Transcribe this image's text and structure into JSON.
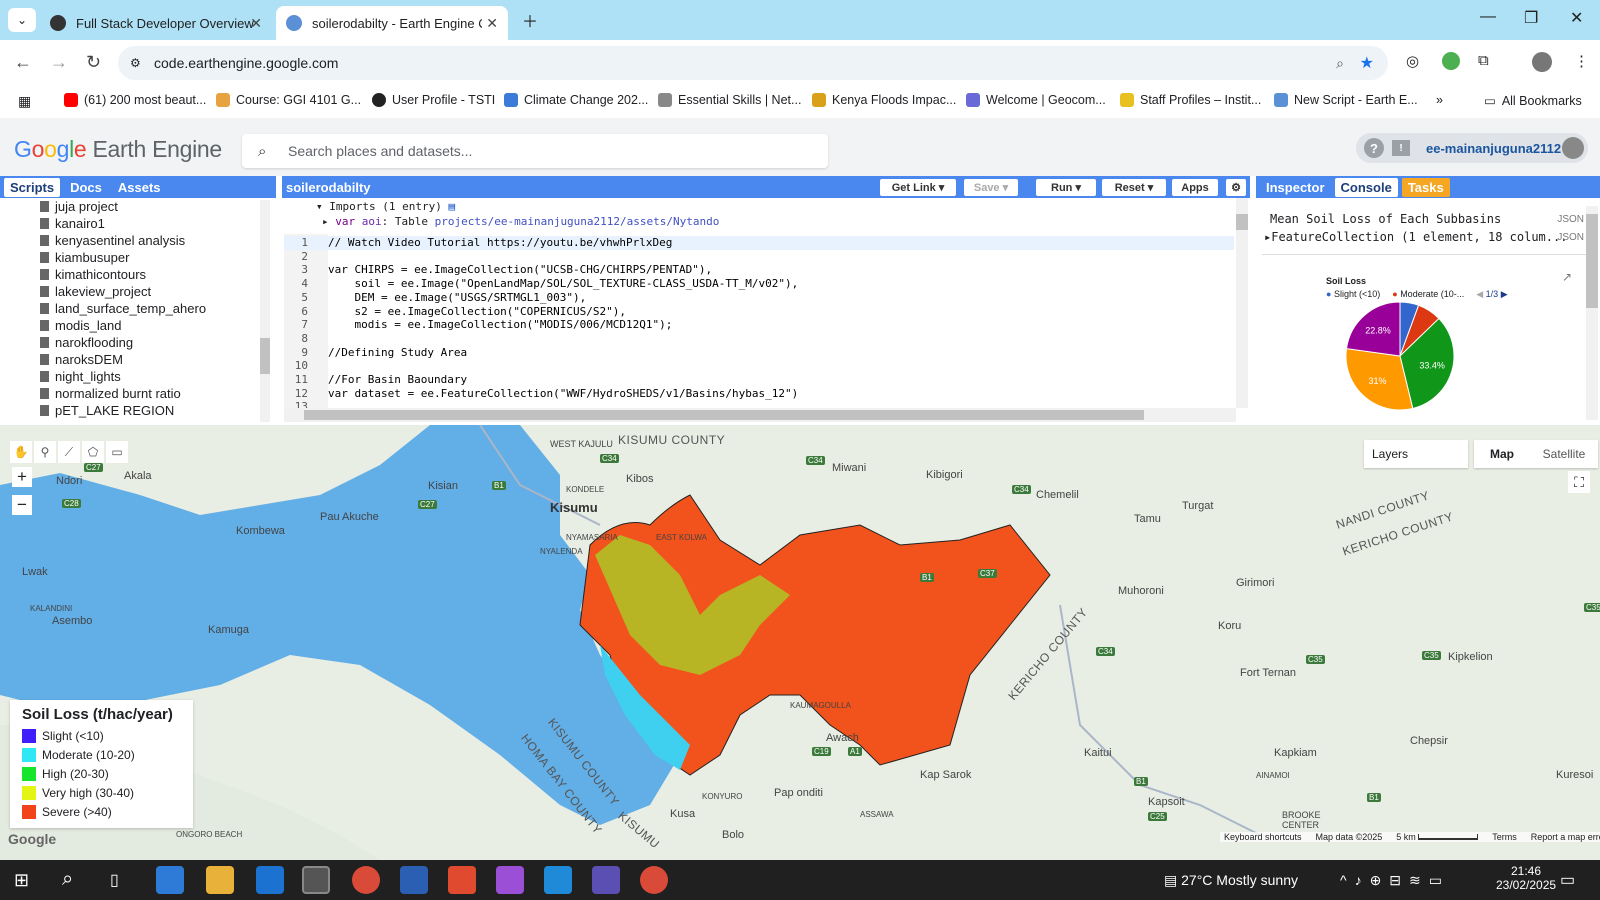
{
  "browser": {
    "tabs": [
      {
        "title": "Full Stack Developer Overview"
      },
      {
        "title": "soilerodabilty - Earth Engine Co"
      }
    ],
    "url": "code.earthengine.google.com",
    "bookmarks": [
      "(61) 200 most beaut...",
      "Course: GGI 4101 G...",
      "User Profile - TSTI",
      "Climate Change 202...",
      "Essential Skills | Net...",
      "Kenya Floods Impac...",
      "Welcome | Geocom...",
      "Staff Profiles – Instit...",
      "New Script - Earth E..."
    ],
    "all_bookmarks": "All Bookmarks"
  },
  "gee": {
    "logo": {
      "google": "Google",
      "product": "Earth Engine"
    },
    "search_placeholder": "Search places and datasets...",
    "user": "ee-mainanjuguna2112",
    "left_tabs": [
      "Scripts",
      "Docs",
      "Assets"
    ],
    "script_items": [
      "juja project",
      "kanairo1",
      "kenyasentinel analysis",
      "kiambusuper",
      "kimathicontours",
      "lakeview_project",
      "land_surface_temp_ahero",
      "modis_land",
      "narokflooding",
      "naroksDEM",
      "night_lights",
      "normalized burnt ratio",
      "pET_LAKE REGION"
    ],
    "script_name": "soilerodabilty",
    "editor_buttons": {
      "get_link": "Get Link",
      "save": "Save",
      "run": "Run",
      "reset": "Reset",
      "apps": "Apps"
    },
    "imports_header": "Imports (1 entry)",
    "import_line": {
      "prefix": "var ",
      "name": "aoi",
      "type": ": Table ",
      "path": "projects/ee-mainanjuguna2112/assets/Nytando"
    },
    "code_lines": [
      {
        "n": "1",
        "cls": "cmt",
        "text": "// Watch Video Tutorial https://youtu.be/vhwhPrlxDeg"
      },
      {
        "n": "2",
        "cls": "",
        "text": ""
      },
      {
        "n": "3",
        "cls": "",
        "text": "var CHIRPS = ee.ImageCollection(\"UCSB-CHG/CHIRPS/PENTAD\"),"
      },
      {
        "n": "4",
        "cls": "",
        "text": "    soil = ee.Image(\"OpenLandMap/SOL/SOL_TEXTURE-CLASS_USDA-TT_M/v02\"),"
      },
      {
        "n": "5",
        "cls": "",
        "text": "    DEM = ee.Image(\"USGS/SRTMGL1_003\"),"
      },
      {
        "n": "6",
        "cls": "",
        "text": "    s2 = ee.ImageCollection(\"COPERNICUS/S2\"),"
      },
      {
        "n": "7",
        "cls": "",
        "text": "    modis = ee.ImageCollection(\"MODIS/006/MCD12Q1\");"
      },
      {
        "n": "8",
        "cls": "",
        "text": ""
      },
      {
        "n": "9",
        "cls": "cmt",
        "text": "//Defining Study Area"
      },
      {
        "n": "10",
        "cls": "",
        "text": ""
      },
      {
        "n": "11",
        "cls": "cmt",
        "text": "//For Basin Baoundary"
      },
      {
        "n": "12",
        "cls": "",
        "text": "var dataset = ee.FeatureCollection(\"WWF/HydroSHEDS/v1/Basins/hybas_12\")"
      },
      {
        "n": "13",
        "cls": "",
        "text": ""
      }
    ],
    "right_tabs": [
      "Inspector",
      "Console",
      "Tasks"
    ],
    "console": {
      "line1": "Mean Soil Loss of Each Subbasins",
      "line2": "FeatureCollection (1 element, 18 colum...",
      "json_label": "JSON",
      "chart_title": "Soil Loss",
      "chart_legend": [
        "Slight (<10)",
        "Moderate (10-..."
      ],
      "chart_page": "1/3"
    },
    "chart_data": {
      "type": "pie",
      "title": "Soil Loss",
      "categories": [
        "Slight (<10)",
        "Moderate (10-20)",
        "High (20-30)",
        "Very high (30-40)",
        "Severe (>40)"
      ],
      "values": [
        5.6,
        7.2,
        33.4,
        31.0,
        22.8
      ],
      "labels": [
        "",
        "",
        "33.4%",
        "31%",
        "22.8%"
      ],
      "colors": [
        "#3366cc",
        "#dc3912",
        "#109618",
        "#ff9900",
        "#990099"
      ]
    },
    "map_buttons": {
      "layers": "Layers",
      "map": "Map",
      "satellite": "Satellite"
    },
    "legend": {
      "title": "Soil Loss (t/hac/year)",
      "items": [
        {
          "label": "Slight (<10)",
          "color": "#3f1dff"
        },
        {
          "label": "Moderate (10-20)",
          "color": "#2ee9f5"
        },
        {
          "label": "High (20-30)",
          "color": "#15e62d"
        },
        {
          "label": "Very high (30-40)",
          "color": "#e4f516"
        },
        {
          "label": "Severe (>40)",
          "color": "#f3431a"
        }
      ]
    },
    "map_labels": {
      "kisumu_county": "KISUMU COUNTY",
      "west_kajulu": "WEST KAJULU",
      "kisumu": "Kisumu",
      "kibos": "Kibos",
      "kisian": "Kisian",
      "kondele": "KONDELE",
      "nyamasaria": "NYAMASARIA",
      "nyalenda": "NYALENDA",
      "east_kolwa": "EAST KOLWA",
      "miwani": "Miwani",
      "kibigori": "Kibigori",
      "chemelil": "Chemelil",
      "tamu": "Tamu",
      "turgat": "Turgat",
      "nandi_county": "NANDI COUNTY",
      "kericho_county": "KERICHO COUNTY",
      "ndori": "Ndori",
      "akala": "Akala",
      "pau_akuche": "Pau Akuche",
      "kombewa": "Kombewa",
      "lwak": "Lwak",
      "kalandini": "KALANDINI",
      "asembo": "Asembo",
      "kamuga": "Kamuga",
      "muhoroni": "Muhoroni",
      "girimori": "Girimori",
      "koru": "Koru",
      "fort_ternan": "Fort Ternan",
      "kipkelion": "Kipkelion",
      "kericho_county2": "KERICHO COUNTY",
      "kaumagoulla": "KAUMAGOULLA",
      "awach": "Awach",
      "kap_sarok": "Kap Sarok",
      "kisumu_county2": "KISUMU COUNTY",
      "homa_bay": "HOMA BAY COUNTY",
      "konyuro": "KONYURO",
      "pap_onditi": "Pap onditi",
      "assawa": "ASSAWA",
      "kusa": "Kusa",
      "bolo": "Bolo",
      "kisumu3": "KISUMU",
      "kaitui": "Kaitui",
      "kapkiam": "Kapkiam",
      "chepsir": "Chepsir",
      "kuresoi": "Kuresoi",
      "ainamoi": "AINAMOI",
      "kapsoit": "Kapsoit",
      "brooke": "BROOKE",
      "center": "CENTER",
      "ongoro": "ONGORO BEACH"
    },
    "map_footer": {
      "shortcuts": "Keyboard shortcuts",
      "data": "Map data ©2025",
      "scale": "5 km",
      "terms": "Terms",
      "report": "Report a map error",
      "google": "Google"
    }
  },
  "taskbar": {
    "weather": "27°C  Mostly sunny",
    "time": "21:46",
    "date": "23/02/2025"
  }
}
